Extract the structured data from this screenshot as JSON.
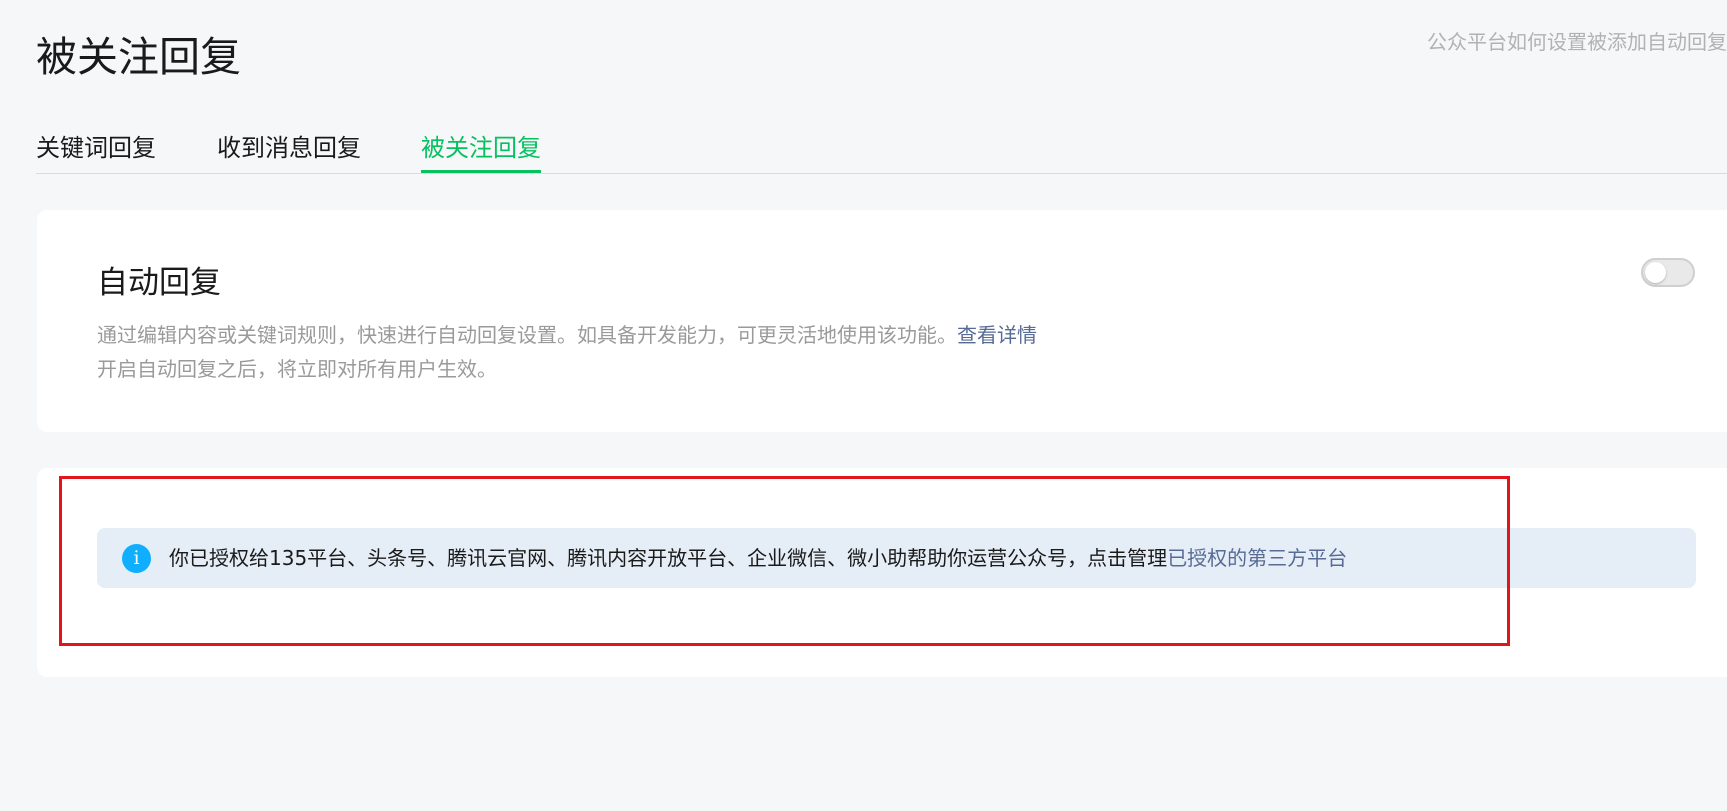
{
  "page": {
    "title": "被关注回复",
    "help_link": "公众平台如何设置被添加自动回复"
  },
  "tabs": [
    {
      "label": "关键词回复",
      "active": false
    },
    {
      "label": "收到消息回复",
      "active": false
    },
    {
      "label": "被关注回复",
      "active": true
    }
  ],
  "auto_reply": {
    "title": "自动回复",
    "desc_line1": "通过编辑内容或关键词规则，快速进行自动回复设置。如具备开发能力，可更灵活地使用该功能。",
    "detail_link": "查看详情",
    "desc_line2": "开启自动回复之后，将立即对所有用户生效。",
    "toggle_on": false
  },
  "auth_notice": {
    "icon": "info-icon",
    "text": "你已授权给135平台、头条号、腾讯云官网、腾讯内容开放平台、企业微信、微小助帮助你运营公众号，点击管理",
    "link": "已授权的第三方平台"
  },
  "colors": {
    "accent_green": "#07c160",
    "link_blue": "#576b95",
    "info_blue": "#10aeff",
    "notice_bg": "#e5edf7",
    "highlight_red": "#e0161b"
  }
}
